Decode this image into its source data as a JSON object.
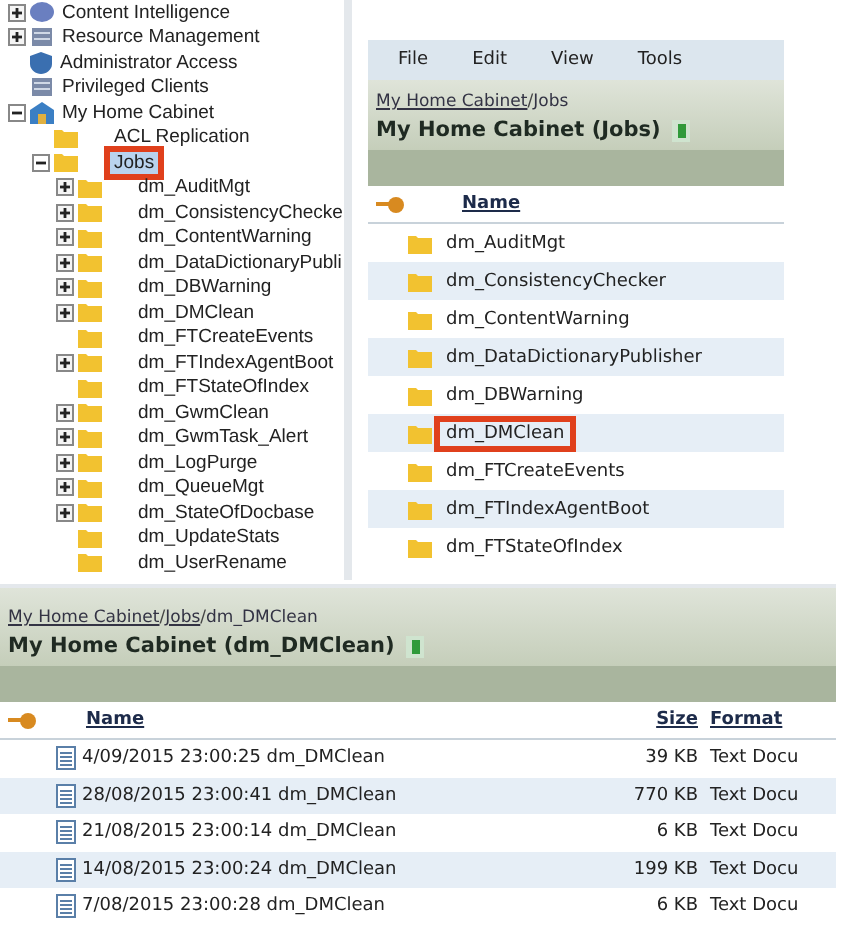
{
  "tree": {
    "items": [
      {
        "label": "Content Intelligence",
        "kind": "service",
        "expanded": false,
        "selected": false,
        "highlighted": false
      },
      {
        "label": "Resource Management",
        "kind": "server",
        "expanded": false,
        "selected": false,
        "highlighted": false
      },
      {
        "label": "Administrator Access",
        "kind": "admin",
        "selected": false,
        "highlighted": false
      },
      {
        "label": "Privileged Clients",
        "kind": "server",
        "selected": false,
        "highlighted": false
      },
      {
        "label": "My Home Cabinet",
        "kind": "cabinet",
        "expanded": true,
        "selected": false,
        "highlighted": false,
        "children": [
          {
            "label": "ACL Replication",
            "kind": "folder",
            "selected": false,
            "highlighted": false
          },
          {
            "label": "Jobs",
            "kind": "folder",
            "expanded": true,
            "selected": true,
            "highlighted": true,
            "children": [
              {
                "label": "dm_AuditMgt",
                "kind": "folder",
                "expanded": false,
                "selected": false,
                "highlighted": false
              },
              {
                "label": "dm_ConsistencyChecke",
                "kind": "folder",
                "expanded": false,
                "selected": false,
                "highlighted": false
              },
              {
                "label": "dm_ContentWarning",
                "kind": "folder",
                "expanded": false,
                "selected": false,
                "highlighted": false
              },
              {
                "label": "dm_DataDictionaryPubli",
                "kind": "folder",
                "expanded": false,
                "selected": false,
                "highlighted": false
              },
              {
                "label": "dm_DBWarning",
                "kind": "folder",
                "expanded": false,
                "selected": false,
                "highlighted": false
              },
              {
                "label": "dm_DMClean",
                "kind": "folder",
                "expanded": false,
                "selected": false,
                "highlighted": false
              },
              {
                "label": "dm_FTCreateEvents",
                "kind": "folder",
                "selected": false,
                "highlighted": false
              },
              {
                "label": "dm_FTIndexAgentBoot",
                "kind": "folder",
                "expanded": false,
                "selected": false,
                "highlighted": false
              },
              {
                "label": "dm_FTStateOfIndex",
                "kind": "folder",
                "selected": false,
                "highlighted": false
              },
              {
                "label": "dm_GwmClean",
                "kind": "folder",
                "expanded": false,
                "selected": false,
                "highlighted": false
              },
              {
                "label": "dm_GwmTask_Alert",
                "kind": "folder",
                "expanded": false,
                "selected": false,
                "highlighted": false
              },
              {
                "label": "dm_LogPurge",
                "kind": "folder",
                "expanded": false,
                "selected": false,
                "highlighted": false
              },
              {
                "label": "dm_QueueMgt",
                "kind": "folder",
                "expanded": false,
                "selected": false,
                "highlighted": false
              },
              {
                "label": "dm_StateOfDocbase",
                "kind": "folder",
                "expanded": false,
                "selected": false,
                "highlighted": false
              },
              {
                "label": "dm_UpdateStats",
                "kind": "folder",
                "selected": false,
                "highlighted": false
              },
              {
                "label": "dm_UserRename",
                "kind": "folder",
                "selected": false,
                "highlighted": false
              }
            ]
          }
        ]
      }
    ]
  },
  "jobs_panel": {
    "menu": [
      "File",
      "Edit",
      "View",
      "Tools"
    ],
    "breadcrumb": {
      "separator": "/",
      "items": [
        "My Home Cabinet",
        "Jobs"
      ]
    },
    "title": "My Home Cabinet (Jobs)",
    "columns": [
      "Name"
    ],
    "rows": [
      {
        "name": "dm_AuditMgt",
        "highlighted": false
      },
      {
        "name": "dm_ConsistencyChecker",
        "highlighted": false
      },
      {
        "name": "dm_ContentWarning",
        "highlighted": false
      },
      {
        "name": "dm_DataDictionaryPublisher",
        "highlighted": false
      },
      {
        "name": "dm_DBWarning",
        "highlighted": false
      },
      {
        "name": "dm_DMClean",
        "highlighted": true
      },
      {
        "name": "dm_FTCreateEvents",
        "highlighted": false
      },
      {
        "name": "dm_FTIndexAgentBoot",
        "highlighted": false
      },
      {
        "name": "dm_FTStateOfIndex",
        "highlighted": false
      }
    ]
  },
  "files_panel": {
    "breadcrumb": {
      "separator": "/",
      "items": [
        "My Home Cabinet",
        "Jobs",
        "dm_DMClean"
      ]
    },
    "title": "My Home Cabinet (dm_DMClean)",
    "columns": [
      "Name",
      "Size",
      "Format"
    ],
    "rows": [
      {
        "name": "4/09/2015 23:00:25 dm_DMClean",
        "size": "39 KB",
        "format": "Text Docu"
      },
      {
        "name": "28/08/2015 23:00:41 dm_DMClean",
        "size": "770 KB",
        "format": "Text Docu"
      },
      {
        "name": "21/08/2015 23:00:14 dm_DMClean",
        "size": "6 KB",
        "format": "Text Docu"
      },
      {
        "name": "14/08/2015 23:00:24 dm_DMClean",
        "size": "199 KB",
        "format": "Text Docu"
      },
      {
        "name": "7/08/2015 23:00:28 dm_DMClean",
        "size": "6 KB",
        "format": "Text Docu"
      }
    ]
  }
}
